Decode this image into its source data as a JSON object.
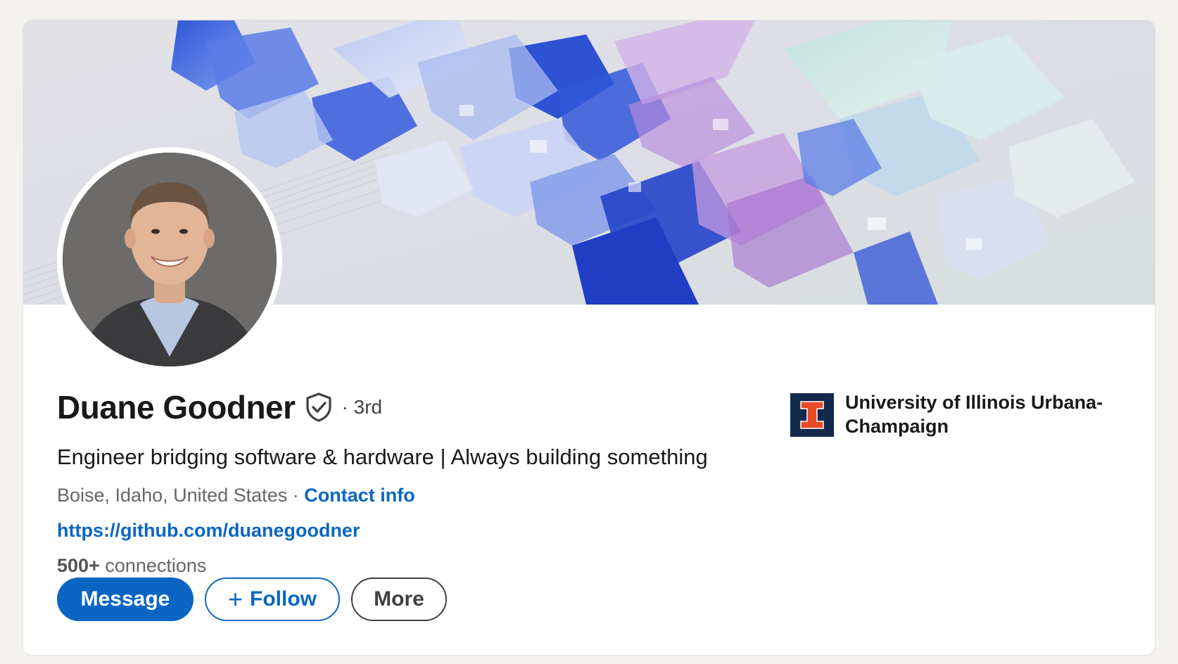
{
  "profile": {
    "name": "Duane Goodner",
    "degree": "· 3rd",
    "headline": "Engineer bridging software & hardware | Always building something",
    "location": "Boise, Idaho, United States",
    "location_separator": " · ",
    "contact_info_label": "Contact info",
    "website": "https://github.com/duanegoodner",
    "connections_count": "500+",
    "connections_label": " connections"
  },
  "actions": {
    "message_label": "Message",
    "follow_plus": "+",
    "follow_label": "Follow",
    "more_label": "More"
  },
  "education": {
    "school_name": "University of Illinois Urbana-Champaign",
    "logo_letter": "I"
  },
  "colors": {
    "accent": "#0a66c2",
    "school_navy": "#13294b",
    "school_orange": "#e84a27",
    "page_bg": "#f4f2ee"
  },
  "icons": {
    "verified": "verified-shield-icon",
    "plus": "plus-icon"
  }
}
